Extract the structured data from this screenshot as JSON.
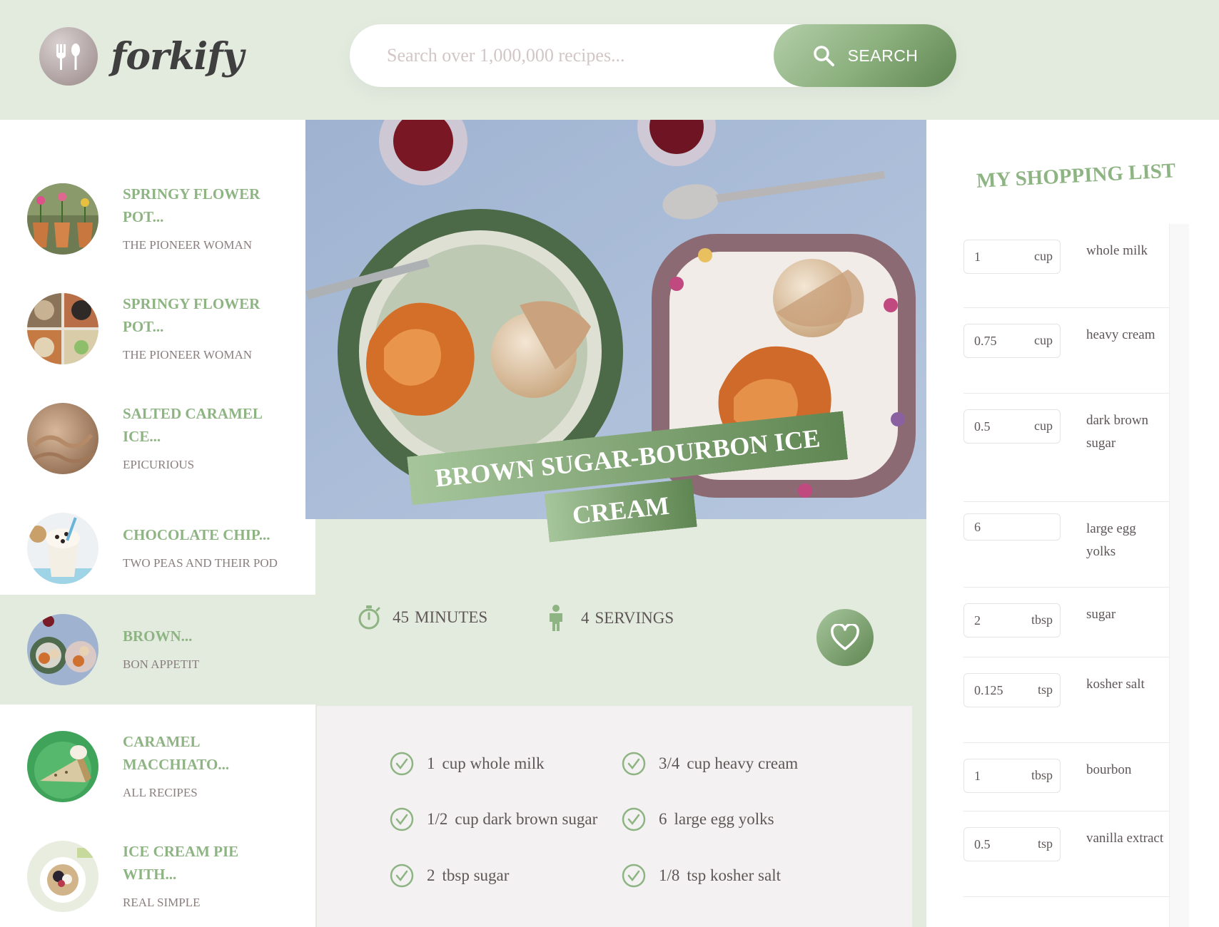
{
  "app": {
    "name": "forkify"
  },
  "search": {
    "placeholder": "Search over 1,000,000 recipes...",
    "button_label": "SEARCH"
  },
  "results": [
    {
      "title": "SPRINGY FLOWER POT...",
      "publisher": "THE PIONEER WOMAN",
      "active": false
    },
    {
      "title": "SPRINGY FLOWER POT...",
      "publisher": "THE PIONEER WOMAN",
      "active": false
    },
    {
      "title": "SALTED CARAMEL ICE...",
      "publisher": "EPICURIOUS",
      "active": false
    },
    {
      "title": "CHOCOLATE CHIP...",
      "publisher": "TWO PEAS AND THEIR POD",
      "active": false
    },
    {
      "title": "BROWN...",
      "publisher": "BON APPETIT",
      "active": true
    },
    {
      "title": "CARAMEL MACCHIATO...",
      "publisher": "ALL RECIPES",
      "active": false
    },
    {
      "title": "ICE CREAM PIE WITH...",
      "publisher": "REAL SIMPLE",
      "active": false
    }
  ],
  "recipe": {
    "title": "BROWN SUGAR-BOURBON ICE CREAM",
    "minutes": "45",
    "minutes_label": "MINUTES",
    "servings": "4",
    "servings_label": "SERVINGS",
    "ingredients": [
      {
        "qty": "1",
        "text": "cup whole milk"
      },
      {
        "qty": "3/4",
        "text": "cup heavy cream"
      },
      {
        "qty": "1/2",
        "text": "cup dark brown sugar"
      },
      {
        "qty": "6",
        "text": "large egg yolks"
      },
      {
        "qty": "2",
        "text": "tbsp sugar"
      },
      {
        "qty": "1/8",
        "text": "tsp kosher salt"
      }
    ]
  },
  "shopping": {
    "heading": "MY SHOPPING LIST",
    "items": [
      {
        "count": "1",
        "unit": "cup",
        "ingredient": "whole milk"
      },
      {
        "count": "0.75",
        "unit": "cup",
        "ingredient": "heavy cream"
      },
      {
        "count": "0.5",
        "unit": "cup",
        "ingredient": "dark brown sugar"
      },
      {
        "count": "6",
        "unit": "",
        "ingredient": "large egg yolks"
      },
      {
        "count": "2",
        "unit": "tbsp",
        "ingredient": "sugar"
      },
      {
        "count": "0.125",
        "unit": "tsp",
        "ingredient": "kosher salt"
      },
      {
        "count": "1",
        "unit": "tbsp",
        "ingredient": "bourbon"
      },
      {
        "count": "0.5",
        "unit": "tsp",
        "ingredient": "vanilla extract"
      }
    ]
  },
  "colors": {
    "accent": "#8db482",
    "accent_dark": "#5f8652",
    "background": "#e3ebdf",
    "text": "#8a7e7e"
  }
}
